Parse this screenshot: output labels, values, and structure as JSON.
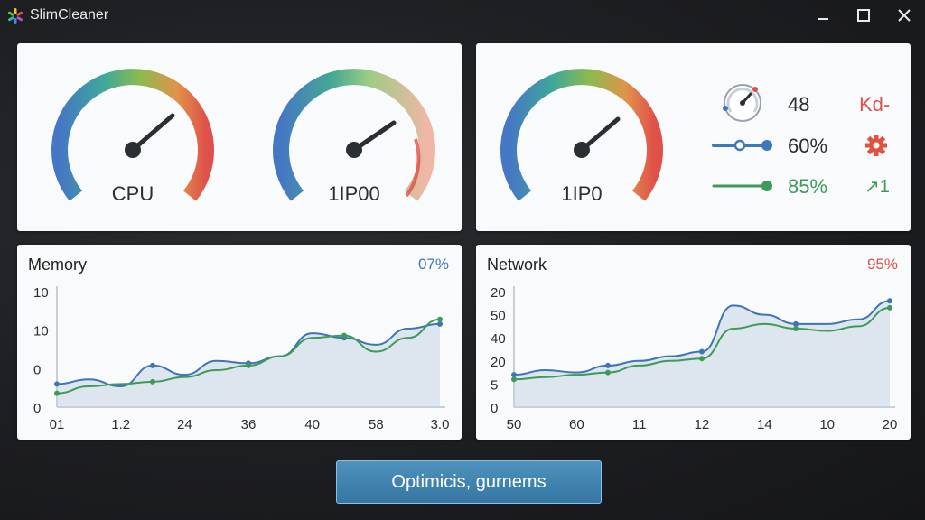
{
  "window": {
    "title": "SlimCleaner"
  },
  "gauges": {
    "cpu": {
      "label": "CPU",
      "level": 0.82
    },
    "gpu": {
      "label": "1IP00",
      "level": 0.72
    },
    "disk": {
      "label": "1IP0",
      "level": 0.76
    }
  },
  "stats": {
    "row1": {
      "value": "48",
      "extra": "Kd-"
    },
    "row2": {
      "value": "60%",
      "slider_level": 0.55
    },
    "row3": {
      "value": "85%",
      "extra": "↗1",
      "slider_level": 0.95
    }
  },
  "memory_chart": {
    "title": "Memory",
    "percent": "07%",
    "colors": {
      "blue": "#3f74b5",
      "green": "#3f9a5a",
      "percent": "#3f78b8"
    }
  },
  "network_chart": {
    "title": "Network",
    "percent": "95%",
    "colors": {
      "blue": "#3f74b5",
      "green": "#3f9a5a",
      "percent": "#d9534f"
    }
  },
  "chart_data": [
    {
      "type": "line",
      "title": "Memory",
      "y_tick_labels": [
        "10",
        "10",
        "0",
        "0"
      ],
      "x_tick_labels": [
        "01",
        "1.2",
        "24",
        "36",
        "40",
        "58",
        "3.0"
      ],
      "series": [
        {
          "values": [
            1.0,
            1.2,
            0.9,
            1.8,
            1.4,
            2.0,
            1.9,
            2.2,
            3.2,
            3.0,
            2.7,
            3.4,
            3.6
          ]
        },
        {
          "values": [
            0.6,
            0.9,
            1.0,
            1.1,
            1.3,
            1.6,
            1.8,
            2.2,
            3.0,
            3.1,
            2.4,
            3.0,
            3.8
          ]
        }
      ]
    },
    {
      "type": "line",
      "title": "Network",
      "y_tick_labels": [
        "20",
        "50",
        "40",
        "20",
        "5",
        "0"
      ],
      "x_tick_labels": [
        "50",
        "60",
        "11",
        "12",
        "14",
        "10",
        "20"
      ],
      "series": [
        {
          "values": [
            1.4,
            1.6,
            1.5,
            1.8,
            2.0,
            2.2,
            2.4,
            4.4,
            4.0,
            3.6,
            3.6,
            3.8,
            4.6
          ]
        },
        {
          "values": [
            1.2,
            1.3,
            1.4,
            1.5,
            1.8,
            2.0,
            2.1,
            3.4,
            3.6,
            3.4,
            3.3,
            3.5,
            4.3
          ]
        }
      ]
    }
  ]
}
